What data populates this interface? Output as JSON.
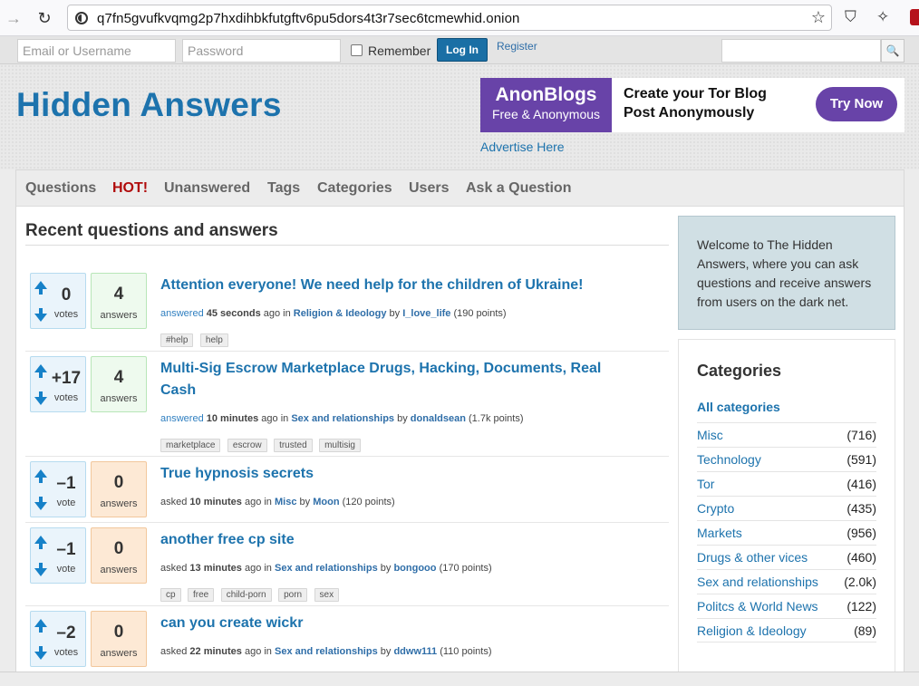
{
  "browser": {
    "url": "q7fn5gvufkvqmg2p7hxdihbkfutgftv6pu5dors4t3r7sec6tcmewhid.onion",
    "back_glyph": "→",
    "reload_glyph": "↻",
    "star_glyph": "☆",
    "shield_glyph": "⛉",
    "magic_glyph": "✧"
  },
  "login": {
    "email_placeholder": "Email or Username",
    "password_placeholder": "Password",
    "remember_label": "Remember",
    "login_label": "Log In",
    "register_label": "Register",
    "search_glyph": "🔍"
  },
  "header": {
    "site_title": "Hidden Answers",
    "ad": {
      "brand": "AnonBlogs",
      "tagline": "Free & Anonymous",
      "headline1": "Create your Tor Blog",
      "headline2": "Post Anonymously",
      "cta": "Try Now"
    },
    "advertise_label": "Advertise Here"
  },
  "nav": {
    "items": [
      "Questions",
      "HOT!",
      "Unanswered",
      "Tags",
      "Categories",
      "Users",
      "Ask a Question"
    ]
  },
  "main": {
    "title": "Recent questions and answers",
    "questions": [
      {
        "votes": "0",
        "votes_label": "votes",
        "answers": "4",
        "answers_label": "answers",
        "title": "Attention everyone! We need help for the children of Ukraine!",
        "what": "answered",
        "when": "45 seconds",
        "ago": "ago in",
        "category": "Religion & Ideology",
        "by": "by",
        "user": "I_love_life",
        "points": "(190 points)",
        "tags": [
          "#help",
          "help"
        ]
      },
      {
        "votes": "+17",
        "votes_label": "votes",
        "answers": "4",
        "answers_label": "answers",
        "title": "Multi-Sig Escrow Marketplace Drugs, Hacking, Documents, Real Cash",
        "what": "answered",
        "when": "10 minutes",
        "ago": "ago in",
        "category": "Sex and relationships",
        "by": "by",
        "user": "donaldsean",
        "points": "(1.7k points)",
        "tags": [
          "marketplace",
          "escrow",
          "trusted",
          "multisig"
        ]
      },
      {
        "votes": "–1",
        "votes_label": "vote",
        "answers": "0",
        "answers_label": "answers",
        "title": "True hypnosis secrets",
        "what": "asked",
        "when": "10 minutes",
        "ago": "ago in",
        "category": "Misc",
        "by": "by",
        "user": "Moon",
        "points": "(120 points)",
        "tags": []
      },
      {
        "votes": "–1",
        "votes_label": "vote",
        "answers": "0",
        "answers_label": "answers",
        "title": "another free cp site",
        "what": "asked",
        "when": "13 minutes",
        "ago": "ago in",
        "category": "Sex and relationships",
        "by": "by",
        "user": "bongooo",
        "points": "(170 points)",
        "tags": [
          "cp",
          "free",
          "child-porn",
          "porn",
          "sex"
        ]
      },
      {
        "votes": "–2",
        "votes_label": "votes",
        "answers": "0",
        "answers_label": "answers",
        "title": "can you create wickr",
        "what": "asked",
        "when": "22 minutes",
        "ago": "ago in",
        "category": "Sex and relationships",
        "by": "by",
        "user": "ddww111",
        "points": "(110 points)",
        "tags": []
      }
    ]
  },
  "sidebar": {
    "welcome": "Welcome to The Hidden Answers, where you can ask questions and receive answers from users on the dark net.",
    "categories_title": "Categories",
    "all_label": "All categories",
    "categories": [
      {
        "name": "Misc",
        "count": "(716)"
      },
      {
        "name": "Technology",
        "count": "(591)"
      },
      {
        "name": "Tor",
        "count": "(416)"
      },
      {
        "name": "Crypto",
        "count": "(435)"
      },
      {
        "name": "Markets",
        "count": "(956)"
      },
      {
        "name": "Drugs & other vices",
        "count": "(460)"
      },
      {
        "name": "Sex and relationships",
        "count": "(2.0k)"
      },
      {
        "name": "Politcs & World News",
        "count": "(122)"
      },
      {
        "name": "Religion & Ideology",
        "count": "(89)"
      }
    ]
  },
  "colors": {
    "brand_blue": "#1d73ad",
    "hot_red": "#b00b0b",
    "ad_purple": "#6843a8"
  }
}
